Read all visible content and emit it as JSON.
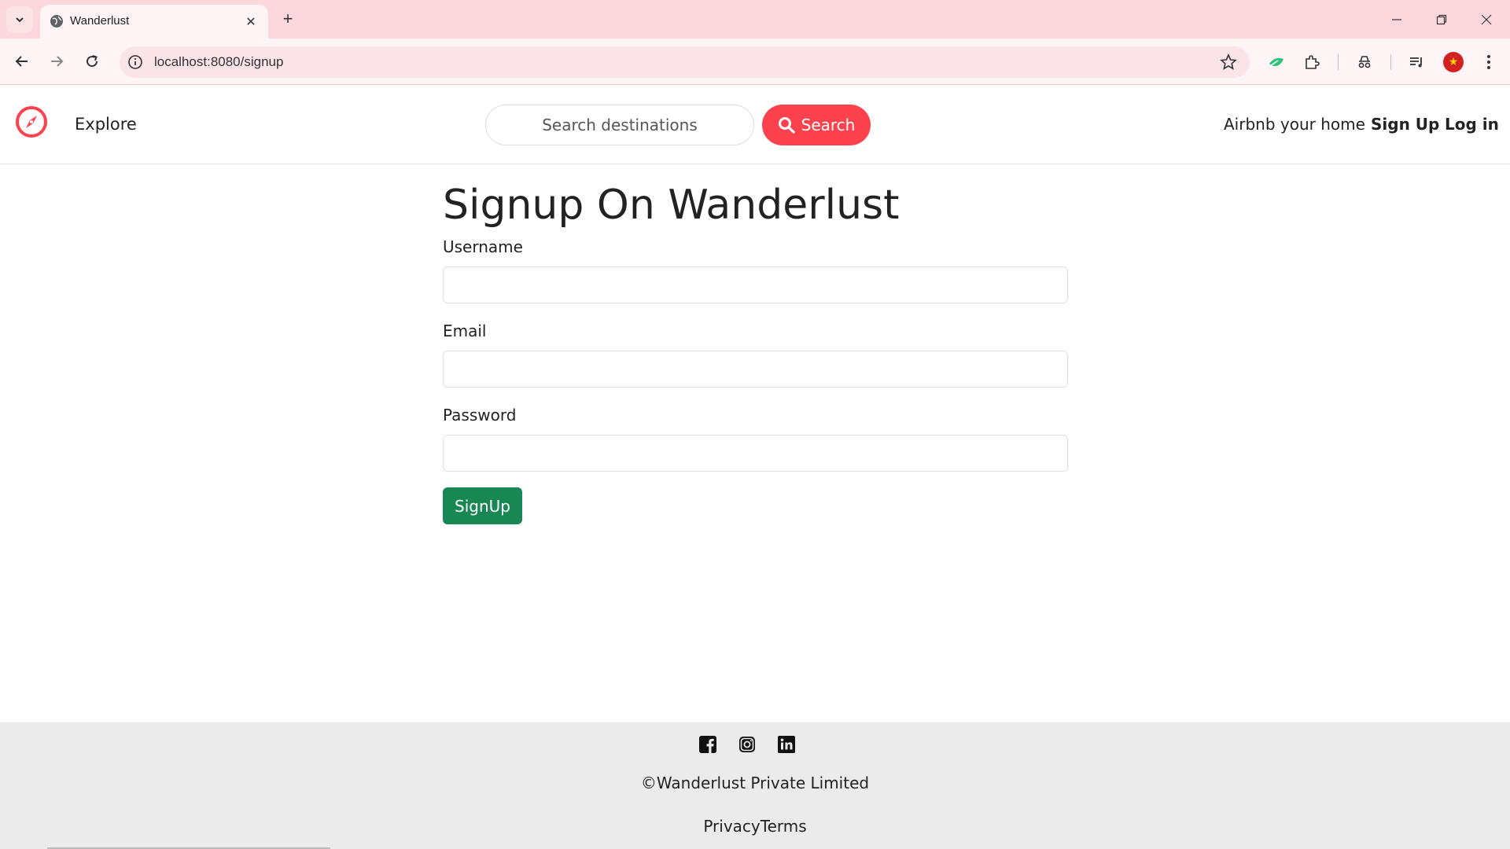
{
  "browser": {
    "tab_title": "Wanderlust",
    "url": "localhost:8080/signup",
    "new_tab_glyph": "+",
    "close_glyph": "✕"
  },
  "site_nav": {
    "explore": "Explore",
    "search_placeholder": "Search destinations",
    "search_button": "Search",
    "host_link": "Airbnb your home",
    "signup_link": "Sign Up",
    "login_link": "Log in"
  },
  "form": {
    "title": "Signup On Wanderlust",
    "username_label": "Username",
    "email_label": "Email",
    "password_label": "Password",
    "username_value": "",
    "email_value": "",
    "password_value": "",
    "submit_label": "SignUp"
  },
  "footer": {
    "copyright": "©Wanderlust Private Limited",
    "privacy": "Privacy",
    "terms": "Terms",
    "social_icons": [
      "facebook-icon",
      "instagram-icon",
      "linkedin-icon"
    ]
  },
  "colors": {
    "brand": "#fe424d",
    "submit": "#198754",
    "chrome_tabbar": "#fcd8dd"
  }
}
